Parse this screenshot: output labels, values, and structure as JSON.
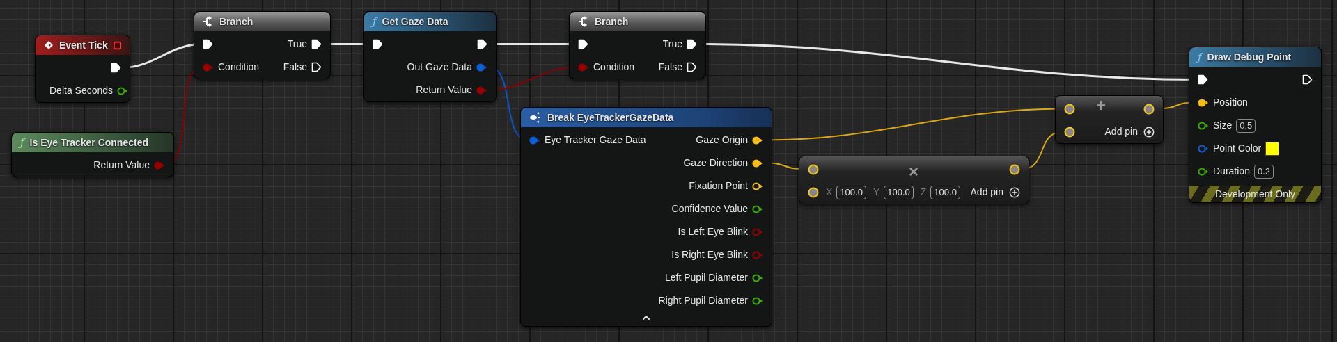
{
  "nodes": [
    {
      "kind": "event",
      "title": "Event Tick",
      "delegate_pin": true,
      "rows": [
        {
          "right": {
            "kind": "exec",
            "connected": true
          }
        },
        {
          "right": {
            "kind": "float",
            "label": "Delta Seconds",
            "connected": false
          }
        }
      ]
    },
    {
      "kind": "pure",
      "icon": "ƒ",
      "title": "Is Eye Tracker Connected",
      "rows": [
        {
          "right": {
            "kind": "bool",
            "label": "Return Value",
            "connected": true
          }
        }
      ]
    },
    {
      "kind": "branch",
      "title": "Branch",
      "rows": [
        {
          "left": {
            "kind": "exec",
            "connected": true
          },
          "right": {
            "kind": "exec",
            "label": "True",
            "connected": true
          }
        },
        {
          "left": {
            "kind": "bool",
            "label": "Condition",
            "connected": true
          },
          "right": {
            "kind": "exec",
            "label": "False",
            "connected": false
          }
        }
      ]
    },
    {
      "kind": "function",
      "icon": "ƒ",
      "title": "Get Gaze Data",
      "rows": [
        {
          "left": {
            "kind": "exec",
            "connected": true
          },
          "right": {
            "kind": "exec",
            "connected": true
          }
        },
        {
          "right": {
            "kind": "struct",
            "label": "Out Gaze Data",
            "connected": true
          }
        },
        {
          "right": {
            "kind": "bool",
            "label": "Return Value",
            "connected": true
          }
        }
      ]
    },
    {
      "kind": "branch",
      "title": "Branch",
      "rows": [
        {
          "left": {
            "kind": "exec",
            "connected": true
          },
          "right": {
            "kind": "exec",
            "label": "True",
            "connected": true
          }
        },
        {
          "left": {
            "kind": "bool",
            "label": "Condition",
            "connected": true
          },
          "right": {
            "kind": "exec",
            "label": "False",
            "connected": false
          }
        }
      ]
    },
    {
      "kind": "break",
      "title": "Break EyeTrackerGazeData",
      "collapsible": true,
      "rows": [
        {
          "left": {
            "kind": "struct",
            "label": "Eye Tracker Gaze Data",
            "connected": true
          },
          "right": {
            "kind": "vector",
            "label": "Gaze Origin",
            "connected": true
          }
        },
        {
          "right": {
            "kind": "vector",
            "label": "Gaze Direction",
            "connected": true
          }
        },
        {
          "right": {
            "kind": "vector",
            "label": "Fixation Point",
            "connected": false
          }
        },
        {
          "right": {
            "kind": "float",
            "label": "Confidence Value",
            "connected": false
          }
        },
        {
          "right": {
            "kind": "bool",
            "label": "Is Left Eye Blink",
            "connected": false
          }
        },
        {
          "right": {
            "kind": "bool",
            "label": "Is Right Eye Blink",
            "connected": false
          }
        },
        {
          "right": {
            "kind": "float",
            "label": "Left Pupil Diameter",
            "connected": false
          }
        },
        {
          "right": {
            "kind": "float",
            "label": "Right Pupil Diameter",
            "connected": false
          }
        }
      ]
    },
    {
      "kind": "math",
      "operator": "×",
      "rows": [
        {
          "left": {
            "kind": "math"
          },
          "right": {
            "kind": "math"
          }
        },
        {
          "left": {
            "kind": "math",
            "fields": [
              {
                "axis": "X",
                "value": "100.0"
              },
              {
                "axis": "Y",
                "value": "100.0"
              },
              {
                "axis": "Z",
                "value": "100.0"
              }
            ]
          },
          "right": {
            "kind": "add",
            "label": "Add pin"
          }
        }
      ]
    },
    {
      "kind": "math",
      "operator": "+",
      "rows": [
        {
          "left": {
            "kind": "math"
          },
          "right": {
            "kind": "math"
          }
        },
        {
          "left": {
            "kind": "math"
          },
          "right": {
            "kind": "add",
            "label": "Add pin"
          }
        }
      ]
    },
    {
      "kind": "function",
      "icon": "ƒ",
      "title": "Draw Debug Point",
      "banner": "Development Only",
      "rows": [
        {
          "left": {
            "kind": "exec",
            "connected": true
          },
          "right": {
            "kind": "exec",
            "connected": false
          }
        },
        {
          "left": {
            "kind": "vector",
            "label": "Position",
            "connected": true
          }
        },
        {
          "left": {
            "kind": "float",
            "label": "Size",
            "connected": false,
            "value": "0.5"
          }
        },
        {
          "left": {
            "kind": "struct",
            "label": "Point Color",
            "connected": false,
            "color": "#ffff00"
          }
        },
        {
          "left": {
            "kind": "float",
            "label": "Duration",
            "connected": false,
            "value": "0.2"
          }
        }
      ]
    }
  ]
}
